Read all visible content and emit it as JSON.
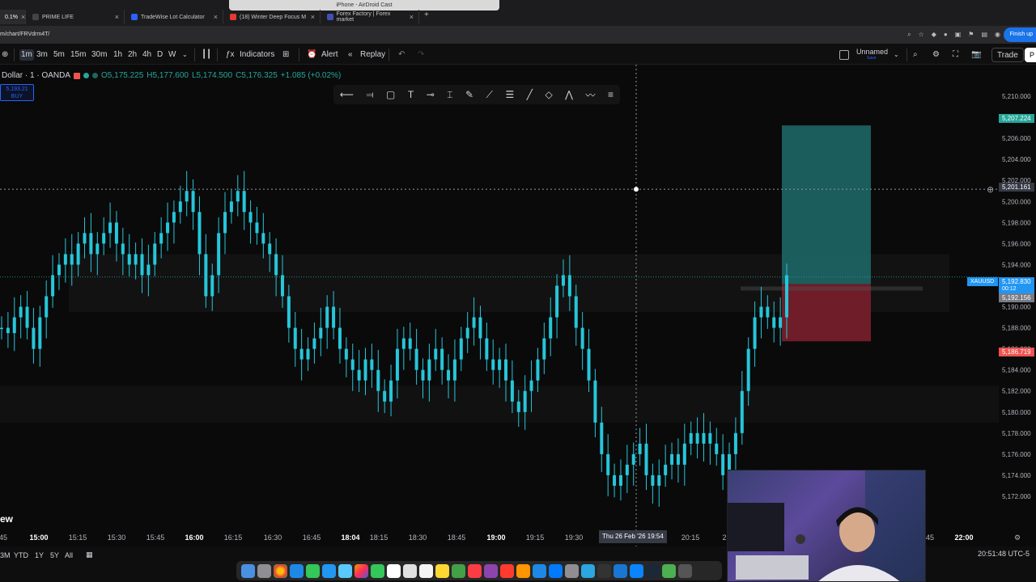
{
  "browser": {
    "tabs": [
      {
        "label": "0.1%",
        "active": true
      },
      {
        "label": "PRIME LIFE"
      },
      {
        "label": "TradeWise Lot Calculator"
      },
      {
        "label": "(18) Winter Deep Focus M"
      },
      {
        "label": "Forex Factory | Forex market"
      }
    ],
    "airdrop_label": "iPhone - AirDroid Cast",
    "url": "m/chart/FRVdrm4T/",
    "finish_label": "Finish up"
  },
  "toolbar": {
    "timeframes": [
      "1m",
      "3m",
      "5m",
      "15m",
      "30m",
      "1h",
      "2h",
      "4h",
      "D",
      "W"
    ],
    "active_timeframe": "1m",
    "indicators_label": "Indicators",
    "alert_label": "Alert",
    "replay_label": "Replay",
    "layout_name": "Unnamed",
    "layout_sub": "Save",
    "trade_label": "Trade",
    "p_label": "P"
  },
  "legend": {
    "symbol": "Dollar · 1 · OANDA",
    "open": "O5,175.225",
    "high": "H5,177.600",
    "low": "L5,174.500",
    "close": "C5,176.325",
    "change": "+1.085 (+0.02%)"
  },
  "buy_box": {
    "price": "5,193.21",
    "label": "BUY"
  },
  "news_label": "ew",
  "price_scale": {
    "levels": [
      "5,210.000",
      "5,208.000",
      "5,206.000",
      "5,204.000",
      "5,202.000",
      "5,200.000",
      "5,198.000",
      "5,196.000",
      "5,194.000",
      "5,192.000",
      "5,190.000",
      "5,188.000",
      "5,186.000",
      "5,184.000",
      "5,182.000",
      "5,180.000",
      "5,178.000",
      "5,176.000",
      "5,174.000",
      "5,172.000"
    ],
    "target_tag": "5,207.224",
    "crosshair_tag": "5,201.161",
    "symbol_tag": "XAUUSD",
    "current_tag": "5,192.830",
    "countdown": "00:12",
    "entry_tag": "5,192.156",
    "stop_tag": "5,186.719"
  },
  "time_scale": {
    "labels": [
      {
        "t": "45"
      },
      {
        "t": "15:00",
        "bold": true
      },
      {
        "t": "15:15"
      },
      {
        "t": "15:30"
      },
      {
        "t": "15:45"
      },
      {
        "t": "16:00",
        "bold": true
      },
      {
        "t": "16:15"
      },
      {
        "t": "16:30"
      },
      {
        "t": "16:45"
      },
      {
        "t": "18:04",
        "bold": true
      },
      {
        "t": "18:15"
      },
      {
        "t": "18:30"
      },
      {
        "t": "18:45"
      },
      {
        "t": "19:00",
        "bold": true
      },
      {
        "t": "19:15"
      },
      {
        "t": "19:30"
      },
      {
        "t": "20:15"
      },
      {
        "t": "2"
      },
      {
        "t": "45"
      },
      {
        "t": "22:00",
        "bold": true
      }
    ],
    "crosshair_date": "Thu 26 Feb '26   19:54"
  },
  "bottom": {
    "ranges": [
      "3M",
      "YTD",
      "1Y",
      "5Y",
      "All"
    ],
    "clock": "20:51:48 UTC-5"
  },
  "colors": {
    "candle": "#26c6da",
    "target_zone": "#1e6b6b",
    "stop_zone": "#7a1f2b",
    "target_tag": "#26a69a",
    "stop_tag": "#ef5350"
  },
  "chart_data": {
    "type": "line",
    "title": "",
    "xlabel": "",
    "ylabel": "",
    "ylim": [
      5170,
      5211
    ],
    "series": [
      {
        "values": [
          5188,
          5187.5,
          5189,
          5190,
          5188,
          5186,
          5189,
          5191,
          5193,
          5194,
          5195,
          5194,
          5196,
          5197,
          5195,
          5196,
          5197,
          5198,
          5196,
          5195,
          5194,
          5195,
          5193,
          5194,
          5196,
          5197,
          5198,
          5199,
          5200,
          5201,
          5199,
          5195,
          5191,
          5193,
          5197,
          5199,
          5200,
          5201,
          5199,
          5198,
          5197,
          5196,
          5195,
          5193,
          5191,
          5188,
          5186,
          5185,
          5186,
          5187,
          5188,
          5190,
          5188,
          5186,
          5185,
          5184,
          5183,
          5185,
          5184,
          5182,
          5181,
          5183,
          5186,
          5187,
          5186,
          5184,
          5183,
          5185,
          5186,
          5184,
          5183,
          5185,
          5187,
          5188,
          5189,
          5187,
          5185,
          5184,
          5185,
          5183,
          5181,
          5180,
          5182,
          5183,
          5185,
          5187,
          5189,
          5192,
          5193,
          5191,
          5188,
          5186,
          5183,
          5179,
          5176,
          5174,
          5173,
          5174,
          5175,
          5176,
          5177,
          5174,
          5173,
          5174,
          5175,
          5176,
          5175,
          5177,
          5178,
          5177,
          5178,
          5177,
          5176,
          5174,
          5176,
          5178,
          5182,
          5186,
          5189,
          5190,
          5189,
          5188,
          5189,
          5193
        ]
      }
    ]
  }
}
